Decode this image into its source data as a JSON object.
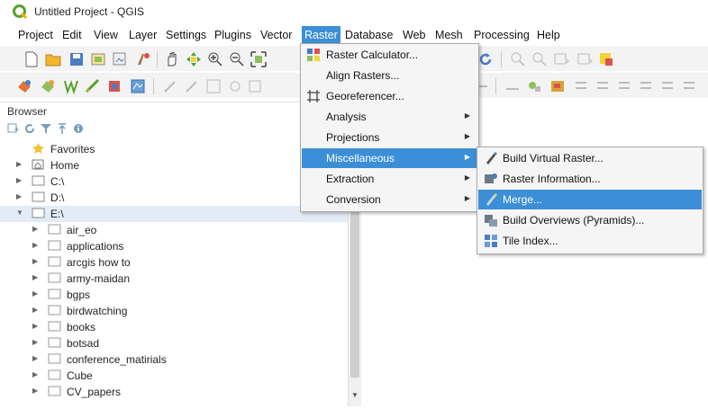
{
  "window": {
    "title": "Untitled Project - QGIS"
  },
  "menubar": [
    {
      "label": "Project"
    },
    {
      "label": "Edit"
    },
    {
      "label": "View"
    },
    {
      "label": "Layer"
    },
    {
      "label": "Settings"
    },
    {
      "label": "Plugins"
    },
    {
      "label": "Vector"
    },
    {
      "label": "Raster"
    },
    {
      "label": "Database"
    },
    {
      "label": "Web"
    },
    {
      "label": "Mesh"
    },
    {
      "label": "Processing"
    },
    {
      "label": "Help"
    }
  ],
  "raster_menu": [
    {
      "label": "Raster Calculator...",
      "icon": "raster-calculator-icon"
    },
    {
      "label": "Align Rasters...",
      "icon": ""
    },
    {
      "label": "Georeferencer...",
      "icon": "georeferencer-icon"
    },
    {
      "label": "Analysis",
      "submenu": true
    },
    {
      "label": "Projections",
      "submenu": true
    },
    {
      "label": "Miscellaneous",
      "submenu": true,
      "highlighted": true
    },
    {
      "label": "Extraction",
      "submenu": true
    },
    {
      "label": "Conversion",
      "submenu": true
    }
  ],
  "misc_menu": [
    {
      "label": "Build Virtual Raster...",
      "icon": "build-virtual-raster-icon"
    },
    {
      "label": "Raster Information...",
      "icon": "raster-information-icon"
    },
    {
      "label": "Merge...",
      "icon": "merge-icon",
      "highlighted": true
    },
    {
      "label": "Build Overviews (Pyramids)...",
      "icon": "build-overviews-icon"
    },
    {
      "label": "Tile Index...",
      "icon": "tile-index-icon"
    }
  ],
  "browser": {
    "title": "Browser",
    "tree": [
      {
        "label": "Favorites",
        "icon": "star-icon",
        "level": 0,
        "arrow": ""
      },
      {
        "label": "Home",
        "icon": "home-icon",
        "level": 0,
        "arrow": "▸"
      },
      {
        "label": "C:\\",
        "icon": "drive-icon",
        "level": 0,
        "arrow": "▸"
      },
      {
        "label": "D:\\",
        "icon": "drive-icon",
        "level": 0,
        "arrow": "▸"
      },
      {
        "label": "E:\\",
        "icon": "drive-icon",
        "level": 0,
        "arrow": "▾",
        "selected": true
      },
      {
        "label": "air_eo",
        "icon": "folder-icon",
        "level": 1,
        "arrow": "▸"
      },
      {
        "label": "applications",
        "icon": "folder-icon",
        "level": 1,
        "arrow": "▸"
      },
      {
        "label": "arcgis how to",
        "icon": "folder-icon",
        "level": 1,
        "arrow": "▸"
      },
      {
        "label": "army-maidan",
        "icon": "folder-icon",
        "level": 1,
        "arrow": "▸"
      },
      {
        "label": "bgps",
        "icon": "folder-icon",
        "level": 1,
        "arrow": "▸"
      },
      {
        "label": "birdwatching",
        "icon": "folder-icon",
        "level": 1,
        "arrow": "▸"
      },
      {
        "label": "books",
        "icon": "folder-icon",
        "level": 1,
        "arrow": "▸"
      },
      {
        "label": "botsad",
        "icon": "folder-icon",
        "level": 1,
        "arrow": "▸"
      },
      {
        "label": "conference_matirials",
        "icon": "folder-icon",
        "level": 1,
        "arrow": "▸"
      },
      {
        "label": "Cube",
        "icon": "folder-icon",
        "level": 1,
        "arrow": "▸"
      },
      {
        "label": "CV_papers",
        "icon": "folder-icon",
        "level": 1,
        "arrow": "▸"
      }
    ]
  },
  "colors": {
    "accent": "#3c8fd6",
    "menu_bg": "#f5f5f5",
    "toolbar_bg": "#f3f3f3",
    "qgis_green": "#5aa02c"
  }
}
